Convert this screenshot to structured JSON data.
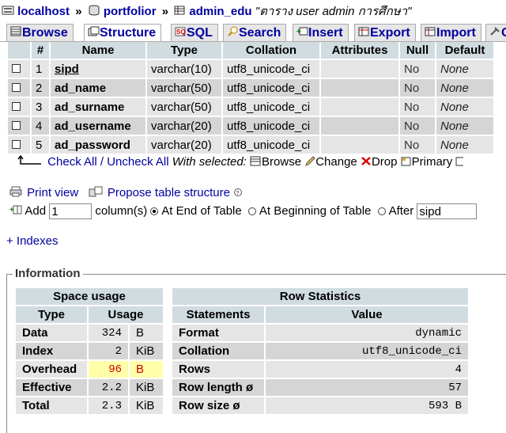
{
  "breadcrumb": {
    "server": "localhost",
    "database": "portfolior",
    "table": "admin_edu",
    "comment": "\"ตาราง user admin การศึกษา\"",
    "separator": "»"
  },
  "tabs": [
    {
      "label": "Browse",
      "icon": "browse-icon"
    },
    {
      "label": "Structure",
      "icon": "structure-icon",
      "active": true
    },
    {
      "label": "SQL",
      "icon": "sql-icon"
    },
    {
      "label": "Search",
      "icon": "search-icon"
    },
    {
      "label": "Insert",
      "icon": "insert-icon"
    },
    {
      "label": "Export",
      "icon": "export-icon"
    },
    {
      "label": "Import",
      "icon": "import-icon"
    },
    {
      "label": "O",
      "icon": "operations-icon"
    }
  ],
  "structure": {
    "headers": [
      "",
      "#",
      "Name",
      "Type",
      "Collation",
      "Attributes",
      "Null",
      "Default"
    ],
    "rows": [
      {
        "num": "1",
        "name": "sipd",
        "type": "varchar(10)",
        "collation": "utf8_unicode_ci",
        "attributes": "",
        "null": "No",
        "default": "None",
        "primary": true
      },
      {
        "num": "2",
        "name": "ad_name",
        "type": "varchar(50)",
        "collation": "utf8_unicode_ci",
        "attributes": "",
        "null": "No",
        "default": "None"
      },
      {
        "num": "3",
        "name": "ad_surname",
        "type": "varchar(50)",
        "collation": "utf8_unicode_ci",
        "attributes": "",
        "null": "No",
        "default": "None"
      },
      {
        "num": "4",
        "name": "ad_username",
        "type": "varchar(20)",
        "collation": "utf8_unicode_ci",
        "attributes": "",
        "null": "No",
        "default": "None"
      },
      {
        "num": "5",
        "name": "ad_password",
        "type": "varchar(20)",
        "collation": "utf8_unicode_ci",
        "attributes": "",
        "null": "No",
        "default": "None"
      }
    ]
  },
  "selection": {
    "check_all": "Check All",
    "slash": " / ",
    "uncheck_all": "Uncheck All",
    "with_selected": "With selected:",
    "browse": "Browse",
    "change": "Change",
    "drop": "Drop",
    "primary": "Primary"
  },
  "actions": {
    "print_view": "Print view",
    "propose": "Propose table structure",
    "add_label": "Add",
    "add_value": "1",
    "columns_label": "column(s)",
    "end_of_table": "At End of Table",
    "beginning_of_table": "At Beginning of Table",
    "after": "After",
    "after_value": "sipd"
  },
  "indexes_link": "+ Indexes",
  "information": {
    "legend": "Information",
    "space_usage": {
      "title": "Space usage",
      "headers": [
        "Type",
        "Usage"
      ],
      "rows": [
        {
          "type": "Data",
          "value": "324",
          "unit": "B"
        },
        {
          "type": "Index",
          "value": "2",
          "unit": "KiB"
        },
        {
          "type": "Overhead",
          "value": "96",
          "unit": "B",
          "warn": true
        },
        {
          "type": "Effective",
          "value": "2.2",
          "unit": "KiB"
        },
        {
          "type": "Total",
          "value": "2.3",
          "unit": "KiB"
        }
      ]
    },
    "row_statistics": {
      "title": "Row Statistics",
      "headers": [
        "Statements",
        "Value"
      ],
      "rows": [
        {
          "statement": "Format",
          "value": "dynamic"
        },
        {
          "statement": "Collation",
          "value": "utf8_unicode_ci"
        },
        {
          "statement": "Rows",
          "value": "4"
        },
        {
          "statement": "Row length ø",
          "value": "57"
        },
        {
          "statement": "Row size ø",
          "value": "593 B"
        }
      ]
    }
  },
  "colors": {
    "link": "#0000a0",
    "header_bg": "#d0dce0",
    "row_odd": "#e5e5e5",
    "row_even": "#d5d5d5",
    "warn_bg": "#ffffaa",
    "warn_text": "#cc0000"
  }
}
